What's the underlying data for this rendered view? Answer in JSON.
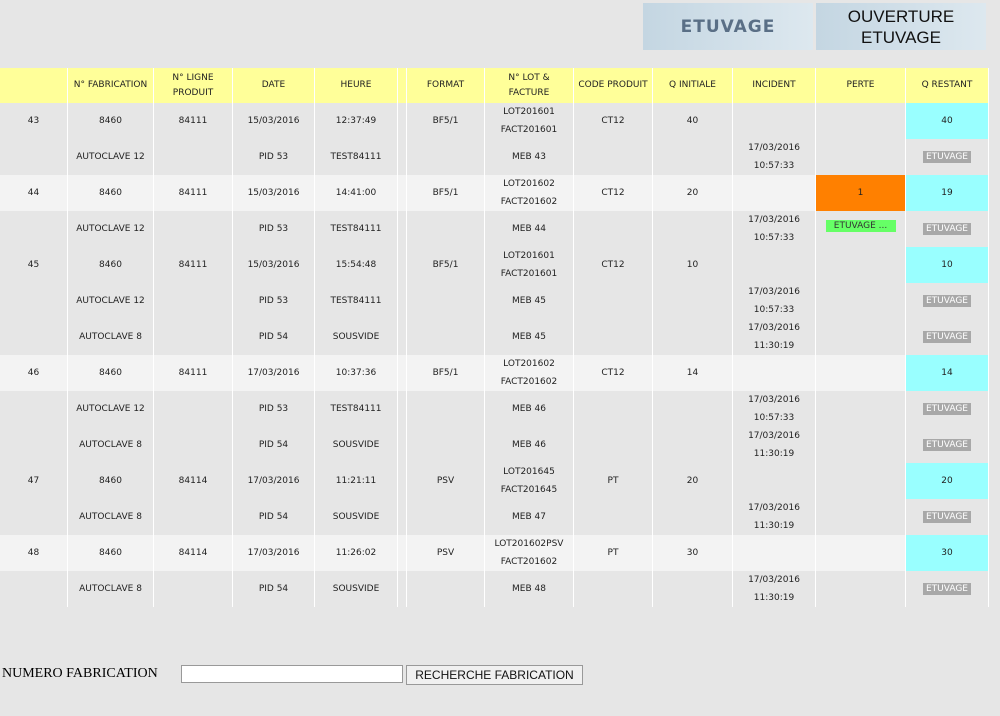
{
  "buttons": {
    "etuvage": "ETUVAGE",
    "ouverture_line1": "OUVERTURE",
    "ouverture_line2": "ETUVAGE"
  },
  "headers": [
    "",
    "N° FABRICATION",
    "N° LIGNE PRODUIT",
    "DATE",
    "HEURE",
    "",
    "FORMAT",
    "N° LOT & FACTURE",
    "CODE PRODUIT",
    "Q INITIALE",
    "INCIDENT",
    "PERTE",
    "Q RESTANT"
  ],
  "rows": [
    {
      "type": "prod",
      "alt": false,
      "id": "43",
      "fab": "8460",
      "ligne": "84111",
      "date": "15/03/2016",
      "heure": "12:37:49",
      "format": "BF5/1",
      "lot": "LOT201601",
      "facture": "FACT201601",
      "code": "CT12",
      "qinit": "40",
      "perte": "",
      "qrest": "40"
    },
    {
      "type": "sub",
      "autoclave": "AUTOCLAVE 12",
      "pid": "PID 53",
      "recette": "TEST84111",
      "meb": "MEB 43",
      "inc_date": "17/03/2016",
      "inc_time": "10:57:33",
      "green": "",
      "badge": "ETUVAGE"
    },
    {
      "type": "prod",
      "alt": true,
      "id": "44",
      "fab": "8460",
      "ligne": "84111",
      "date": "15/03/2016",
      "heure": "14:41:00",
      "format": "BF5/1",
      "lot": "LOT201602",
      "facture": "FACT201602",
      "code": "CT12",
      "qinit": "20",
      "perte": "1",
      "qrest": "19"
    },
    {
      "type": "sub",
      "autoclave": "AUTOCLAVE 12",
      "pid": "PID 53",
      "recette": "TEST84111",
      "meb": "MEB 44",
      "inc_date": "17/03/2016",
      "inc_time": "10:57:33",
      "green": "ETUVAGE ...",
      "badge": "ETUVAGE"
    },
    {
      "type": "prod",
      "alt": false,
      "id": "45",
      "fab": "8460",
      "ligne": "84111",
      "date": "15/03/2016",
      "heure": "15:54:48",
      "format": "BF5/1",
      "lot": "LOT201601",
      "facture": "FACT201601",
      "code": "CT12",
      "qinit": "10",
      "perte": "",
      "qrest": "10"
    },
    {
      "type": "sub",
      "autoclave": "AUTOCLAVE 12",
      "pid": "PID 53",
      "recette": "TEST84111",
      "meb": "MEB 45",
      "inc_date": "17/03/2016",
      "inc_time": "10:57:33",
      "green": "",
      "badge": "ETUVAGE"
    },
    {
      "type": "sub",
      "autoclave": "AUTOCLAVE 8",
      "pid": "PID 54",
      "recette": "SOUSVIDE",
      "meb": "MEB 45",
      "inc_date": "17/03/2016",
      "inc_time": "11:30:19",
      "green": "",
      "badge": "ETUVAGE"
    },
    {
      "type": "prod",
      "alt": true,
      "id": "46",
      "fab": "8460",
      "ligne": "84111",
      "date": "17/03/2016",
      "heure": "10:37:36",
      "format": "BF5/1",
      "lot": "LOT201602",
      "facture": "FACT201602",
      "code": "CT12",
      "qinit": "14",
      "perte": "",
      "qrest": "14"
    },
    {
      "type": "sub",
      "autoclave": "AUTOCLAVE 12",
      "pid": "PID 53",
      "recette": "TEST84111",
      "meb": "MEB 46",
      "inc_date": "17/03/2016",
      "inc_time": "10:57:33",
      "green": "",
      "badge": "ETUVAGE"
    },
    {
      "type": "sub",
      "autoclave": "AUTOCLAVE 8",
      "pid": "PID 54",
      "recette": "SOUSVIDE",
      "meb": "MEB 46",
      "inc_date": "17/03/2016",
      "inc_time": "11:30:19",
      "green": "",
      "badge": "ETUVAGE"
    },
    {
      "type": "prod",
      "alt": false,
      "id": "47",
      "fab": "8460",
      "ligne": "84114",
      "date": "17/03/2016",
      "heure": "11:21:11",
      "format": "PSV",
      "lot": "LOT201645",
      "facture": "FACT201645",
      "code": "PT",
      "qinit": "20",
      "perte": "",
      "qrest": "20"
    },
    {
      "type": "sub",
      "autoclave": "AUTOCLAVE 8",
      "pid": "PID 54",
      "recette": "SOUSVIDE",
      "meb": "MEB 47",
      "inc_date": "17/03/2016",
      "inc_time": "11:30:19",
      "green": "",
      "badge": "ETUVAGE"
    },
    {
      "type": "prod",
      "alt": true,
      "id": "48",
      "fab": "8460",
      "ligne": "84114",
      "date": "17/03/2016",
      "heure": "11:26:02",
      "format": "PSV",
      "lot": "LOT201602PSV",
      "facture": "FACT201602",
      "code": "PT",
      "qinit": "30",
      "perte": "",
      "qrest": "30"
    },
    {
      "type": "sub",
      "autoclave": "AUTOCLAVE 8",
      "pid": "PID 54",
      "recette": "SOUSVIDE",
      "meb": "MEB 48",
      "inc_date": "17/03/2016",
      "inc_time": "11:30:19",
      "green": "",
      "badge": "ETUVAGE"
    }
  ],
  "search": {
    "label": "NUMERO FABRICATION",
    "value": "",
    "placeholder": "",
    "button": "RECHERCHE FABRICATION"
  },
  "colors": {
    "header_bg": "#ffff99",
    "q_restant_bg": "#99ffff",
    "perte_bg": "#ff8000",
    "etuvage_badge_bg": "#a8a8a8",
    "etuvage_green_bg": "#66ff66"
  }
}
